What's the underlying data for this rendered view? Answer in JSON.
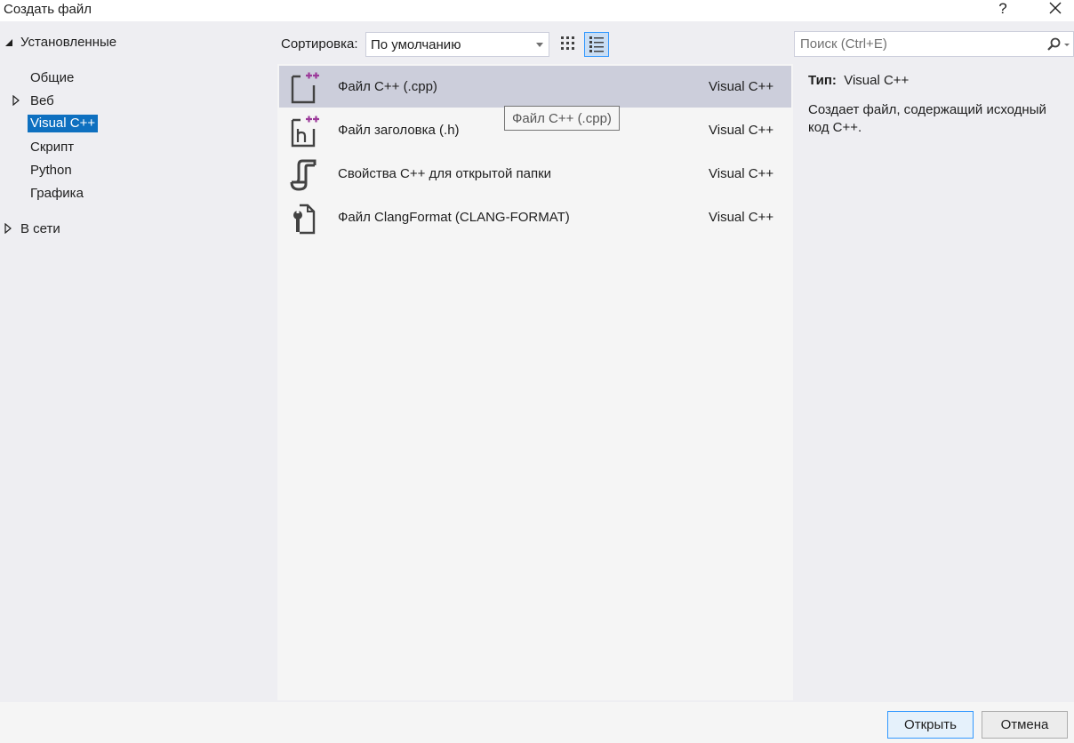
{
  "window": {
    "title": "Создать файл",
    "help_label": "?",
    "close_icon": "close-icon"
  },
  "tree": {
    "installed_label": "Установленные",
    "items": [
      {
        "label": "Общие",
        "expandable": false,
        "selected": false
      },
      {
        "label": "Веб",
        "expandable": true,
        "selected": false
      },
      {
        "label": "Visual C++",
        "expandable": false,
        "selected": true
      },
      {
        "label": "Скрипт",
        "expandable": false,
        "selected": false
      },
      {
        "label": "Python",
        "expandable": false,
        "selected": false
      },
      {
        "label": "Графика",
        "expandable": false,
        "selected": false
      }
    ],
    "online_label": "В сети"
  },
  "toolbar": {
    "sort_label": "Сортировка:",
    "sort_value": "По умолчанию",
    "view_small_icons": "small-icons-view-icon",
    "view_list": "list-view-icon"
  },
  "search": {
    "placeholder": "Поиск (Ctrl+E)",
    "icon": "search-icon"
  },
  "templates": [
    {
      "name": "Файл C++ (.cpp)",
      "lang": "Visual C++",
      "icon": "cpp-file-icon",
      "selected": true
    },
    {
      "name": "Файл заголовка (.h)",
      "lang": "Visual C++",
      "icon": "header-file-icon",
      "selected": false
    },
    {
      "name": "Свойства C++ для открытой папки",
      "lang": "Visual C++",
      "icon": "json-settings-icon",
      "selected": false
    },
    {
      "name": "Файл ClangFormat (CLANG-FORMAT)",
      "lang": "Visual C++",
      "icon": "clang-format-file-icon",
      "selected": false
    }
  ],
  "tooltip": "Файл C++ (.cpp)",
  "details": {
    "type_label": "Тип:",
    "type_value": "Visual C++",
    "description": "Создает файл, содержащий исходный код C++."
  },
  "buttons": {
    "open": "Открыть",
    "cancel": "Отмена"
  },
  "colors": {
    "selection_blue": "#0e70c0",
    "row_selected": "#cccedb",
    "plus_purple": "#9c3a9a",
    "icon_dark": "#424242"
  }
}
